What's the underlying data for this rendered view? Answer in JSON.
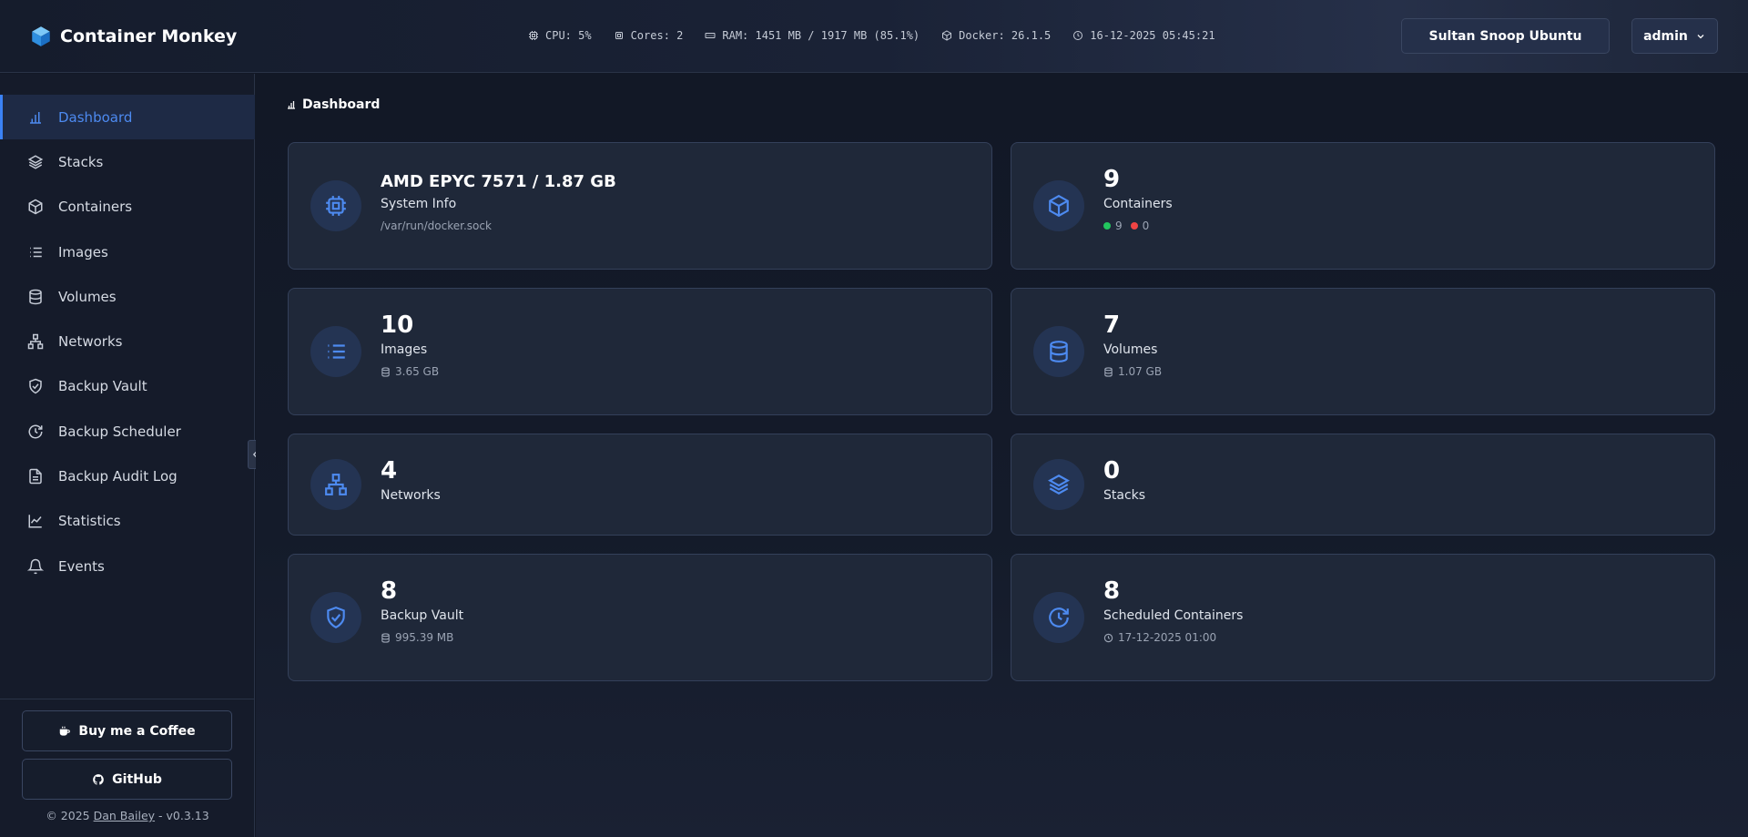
{
  "header": {
    "brand": "Container Monkey",
    "cpu": "CPU: 5%",
    "cores": "Cores: 2",
    "ram": "RAM: 1451 MB / 1917 MB (85.1%)",
    "docker": "Docker: 26.1.5",
    "datetime": "16-12-2025 05:45:21",
    "host_label": "Sultan Snoop Ubuntu",
    "user_label": "admin"
  },
  "sidebar": {
    "items": [
      {
        "label": "Dashboard",
        "icon": "bar-chart-icon",
        "active": true
      },
      {
        "label": "Stacks",
        "icon": "layers-icon"
      },
      {
        "label": "Containers",
        "icon": "box-icon"
      },
      {
        "label": "Images",
        "icon": "list-icon"
      },
      {
        "label": "Volumes",
        "icon": "database-icon"
      },
      {
        "label": "Networks",
        "icon": "network-icon"
      },
      {
        "label": "Backup Vault",
        "icon": "shield-check-icon"
      },
      {
        "label": "Backup Scheduler",
        "icon": "clock-refresh-icon"
      },
      {
        "label": "Backup Audit Log",
        "icon": "file-text-icon"
      },
      {
        "label": "Statistics",
        "icon": "line-chart-icon"
      },
      {
        "label": "Events",
        "icon": "bell-icon"
      }
    ],
    "coffee_label": "Buy me a Coffee",
    "github_label": "GitHub",
    "footer_prefix": "© 2025 ",
    "footer_author": "Dan Bailey",
    "footer_suffix": " - v0.3.13"
  },
  "main": {
    "breadcrumb": "Dashboard",
    "cards": {
      "system": {
        "value": "AMD EPYC 7571 / 1.87 GB",
        "label": "System Info",
        "sub": "/var/run/docker.sock"
      },
      "containers": {
        "value": "9",
        "label": "Containers",
        "running": "9",
        "stopped": "0"
      },
      "images": {
        "value": "10",
        "label": "Images",
        "sub": "3.65 GB"
      },
      "volumes": {
        "value": "7",
        "label": "Volumes",
        "sub": "1.07 GB"
      },
      "networks": {
        "value": "4",
        "label": "Networks"
      },
      "stacks": {
        "value": "0",
        "label": "Stacks"
      },
      "backup": {
        "value": "8",
        "label": "Backup Vault",
        "sub": "995.39 MB"
      },
      "scheduled": {
        "value": "8",
        "label": "Scheduled Containers",
        "sub": "17-12-2025 01:00"
      }
    }
  },
  "colors": {
    "accent": "#3b82f6",
    "running": "#22c55e",
    "stopped": "#ef4444"
  }
}
